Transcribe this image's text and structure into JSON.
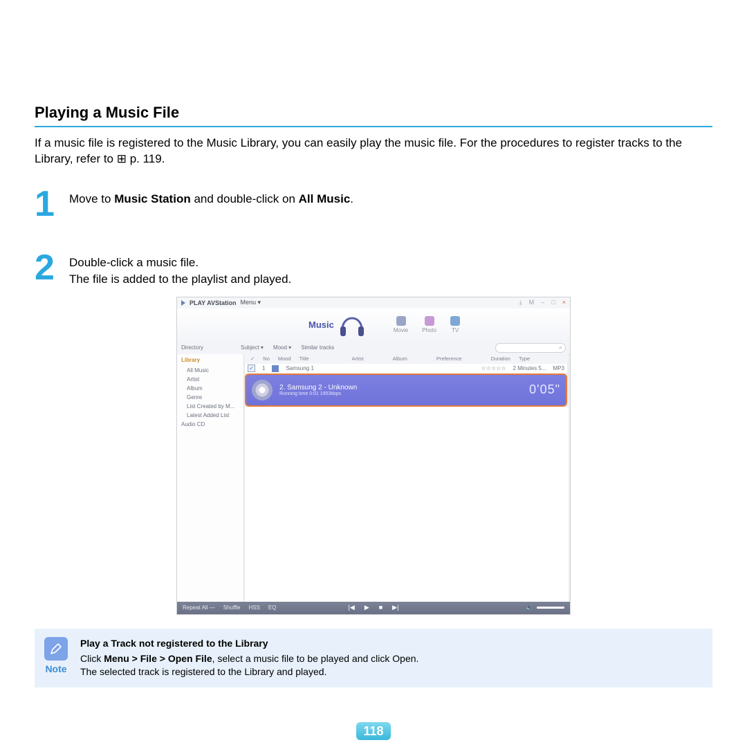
{
  "title": "Playing a Music File",
  "intro_a": "If a music file is registered to the Music Library, you can easily play the music file. For the procedures to register tracks to the Library, refer to ",
  "intro_ref": "⊞ p. 119",
  "intro_b": ".",
  "steps": [
    {
      "num": "1",
      "text_a": "Move to ",
      "bold_a": "Music Station",
      "text_b": " and double-click on ",
      "bold_b": "All Music",
      "text_c": "."
    },
    {
      "num": "2",
      "line1": "Double-click a music file.",
      "line2": "The file is added to the playlist and played."
    }
  ],
  "app": {
    "title_a": "PLAY AVStation",
    "title_b": "Menu ▾",
    "win_chrome": [
      "⤓",
      "M",
      "–",
      "□",
      "×"
    ],
    "main_tab": "Music",
    "tabs": [
      "Movie",
      "Photo",
      "TV"
    ],
    "filters": {
      "directory": "Directory",
      "subject": "Subject ▾",
      "mood": "Mood ▾",
      "similar": "Similar tracks"
    },
    "search_icon": "⌕",
    "columns": [
      "✓",
      "No",
      "Mood",
      "Title",
      "Artist",
      "Album",
      "Preference",
      "Duration",
      "Type"
    ],
    "sidebar": {
      "header": "Library",
      "items": [
        "All Music",
        "Artist",
        "Album",
        "Genre",
        "List Created by M...",
        "Latest Added List",
        "Audio CD"
      ]
    },
    "row1": {
      "no": "1",
      "title": "Samsung 1",
      "pref": "☆☆☆☆☆",
      "duration": "2 Minutes 5...",
      "type": "MP3"
    },
    "now": {
      "label": "2.  Samsung 2 - Unknown",
      "sub": "Running time 0:01     1953kbps",
      "time": "0'05\""
    },
    "player": {
      "left": [
        "Repeat All —",
        "Shuffle",
        "HSS",
        "EQ"
      ],
      "center": [
        "|◀",
        "▶",
        "■",
        "▶|"
      ],
      "vol": "🔈"
    }
  },
  "note": {
    "label": "Note",
    "title": "Play a Track not registered to the Library",
    "line1_a": "Click ",
    "line1_b": "Menu > File > Open File",
    "line1_c": ", select a music file to be played and click Open.",
    "line2": "The selected track is registered to the Library and played."
  },
  "page_number": "118"
}
